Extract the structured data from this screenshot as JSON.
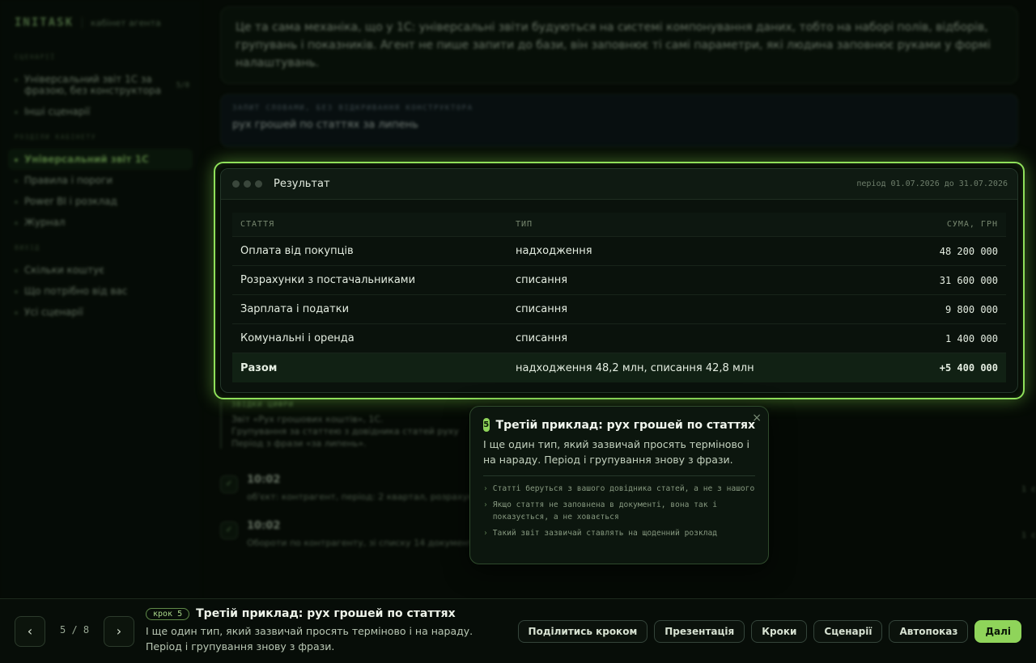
{
  "sidebar": {
    "logo": "INITASK",
    "subtitle": "кабінет агента",
    "groups": [
      {
        "label": "Сценарії",
        "items": [
          {
            "label": "Універсальний звіт 1С за фразою, без конструктора",
            "count": "5/8"
          },
          {
            "label": "Інші сценарії"
          }
        ]
      },
      {
        "label": "Розділи кабінету",
        "items": [
          {
            "label": "Універсальний звіт 1С",
            "active": true
          },
          {
            "label": "Правила і пороги"
          },
          {
            "label": "Power BI і розклад"
          },
          {
            "label": "Журнал"
          }
        ]
      },
      {
        "label": "Вихід",
        "items": [
          {
            "label": "Скільки коштує"
          },
          {
            "label": "Що потрібно від вас"
          },
          {
            "label": "Усі сценарії"
          }
        ]
      }
    ]
  },
  "intro": {
    "text": "Це та сама механіка, що у 1С: універсальні звіти будуються на системі компонування даних, тобто на наборі полів, відборів, групувань і показників. Агент не пише запити до бази, він заповнює ті самі параметри, які людина заповнює руками у формі налаштувань."
  },
  "query": {
    "label": "Запит словами, без відкривання конструктора",
    "text": "рух грошей по статтях за липень"
  },
  "result": {
    "title": "Результат",
    "period": "період 01.07.2026 до 31.07.2026",
    "columns": [
      "Стаття",
      "Тип",
      "Сума, грн"
    ],
    "rows": [
      {
        "article": "Оплата від покупців",
        "type": "надходження",
        "sum": "48 200 000"
      },
      {
        "article": "Розрахунки з постачальниками",
        "type": "списання",
        "sum": "31 600 000"
      },
      {
        "article": "Зарплата і податки",
        "type": "списання",
        "sum": "9 800 000"
      },
      {
        "article": "Комунальні і оренда",
        "type": "списання",
        "sum": "1 400 000"
      }
    ],
    "total": {
      "article": "Разом",
      "type": "надходження 48,2 млн, списання 42,8 млн",
      "sum": "+5 400 000"
    }
  },
  "source": {
    "label": "Звідки цифри",
    "lines": [
      "Звіт «Рух грошових коштів», 1С.",
      "Групування за статтею з довідника статей руху",
      "Період з фрази «за липень»."
    ]
  },
  "log": [
    {
      "time": "10:02",
      "text": "об'єкт: контрагент, період: 2 квартал, розрахунки",
      "dur": "1 с"
    },
    {
      "time": "10:02",
      "text": "Обороти по контрагенту, зі списку 14 документів",
      "dur": "1 с"
    }
  ],
  "popover": {
    "number": "5",
    "title": "Третій приклад: рух грошей по статтях",
    "description": "І ще один тип, який зазвичай просять терміново і на нараду. Період і групування знову з фрази.",
    "bullets": [
      "Статті беруться з вашого довідника статей, а не з нашого",
      "Якщо стаття не заповнена в документі, вона так і показується, а не ховається",
      "Такий звіт зазвичай ставлять на щоденний розклад"
    ],
    "close": "×"
  },
  "bottom": {
    "prev": "‹",
    "next": "›",
    "step_counter": "5 / 8",
    "step_badge": "крок 5",
    "step_title": "Третій приклад: рух грошей по статтях",
    "step_desc": "І ще один тип, який зазвичай просять терміново і на нараду. Період і групування знову з фрази.",
    "actions": [
      {
        "label": "Поділитись кроком"
      },
      {
        "label": "Презентація"
      },
      {
        "label": "Кроки"
      },
      {
        "label": "Сценарії"
      },
      {
        "label": "Автопоказ"
      },
      {
        "label": "Далі",
        "primary": true
      }
    ]
  },
  "colors": {
    "accent": "#8fd45a",
    "background": "#050a05",
    "highlight_border": "#8fe05a"
  }
}
